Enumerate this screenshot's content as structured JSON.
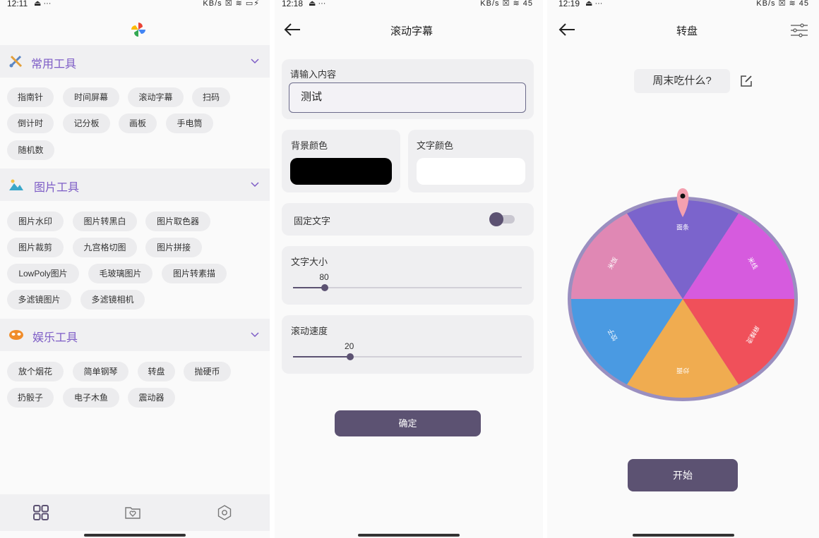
{
  "screen1": {
    "status": {
      "time": "12:11",
      "extra": "⏏ ···",
      "icons": "KB/s ☒ ≋ ▭⚡"
    },
    "sections": [
      {
        "title": "常用工具",
        "icon": "tools-icon",
        "chips": [
          "指南针",
          "时间屏幕",
          "滚动字幕",
          "扫码",
          "倒计时",
          "记分板",
          "画板",
          "手电筒",
          "随机数"
        ]
      },
      {
        "title": "图片工具",
        "icon": "image-icon",
        "chips": [
          "图片水印",
          "图片转黑白",
          "图片取色器",
          "图片裁剪",
          "九宫格切图",
          "图片拼接",
          "LowPoly图片",
          "毛玻璃图片",
          "图片转素描",
          "多滤镜图片",
          "多滤镜相机"
        ]
      },
      {
        "title": "娱乐工具",
        "icon": "mask-icon",
        "chips": [
          "放个烟花",
          "简单钢琴",
          "转盘",
          "抛硬币",
          "扔骰子",
          "电子木鱼",
          "震动器"
        ]
      }
    ],
    "nav": [
      "grid-icon",
      "folder-heart-icon",
      "settings-icon"
    ]
  },
  "screen2": {
    "status": {
      "time": "12:18",
      "extra": "⏏ ···",
      "icons": "KB/s ☒ ≋ 45"
    },
    "title": "滚动字幕",
    "input_label": "请输入内容",
    "input_value": "测试",
    "bg_label": "背景颜色",
    "text_color_label": "文字颜色",
    "bg_color": "#000000",
    "text_color": "#ffffff",
    "fixed_label": "固定文字",
    "fixed_on": false,
    "size_label": "文字大小",
    "size_value": "80",
    "size_fraction": 0.14,
    "speed_label": "滚动速度",
    "speed_value": "20",
    "speed_fraction": 0.25,
    "confirm": "确定"
  },
  "screen3": {
    "status": {
      "time": "12:19",
      "extra": "⏏ ···",
      "icons": "KB/s ☒ ≋ 45"
    },
    "title": "转盘",
    "topic": "周末吃什么?",
    "start": "开始",
    "wheel": [
      {
        "label": "面条",
        "color": "#7b64cc"
      },
      {
        "label": "米线",
        "color": "#d65bde"
      },
      {
        "label": "麻辣烫",
        "color": "#f0505a"
      },
      {
        "label": "炒面",
        "color": "#f0ac50"
      },
      {
        "label": "饺子",
        "color": "#4a9ae2"
      },
      {
        "label": "米饭",
        "color": "#e088b4"
      }
    ]
  }
}
